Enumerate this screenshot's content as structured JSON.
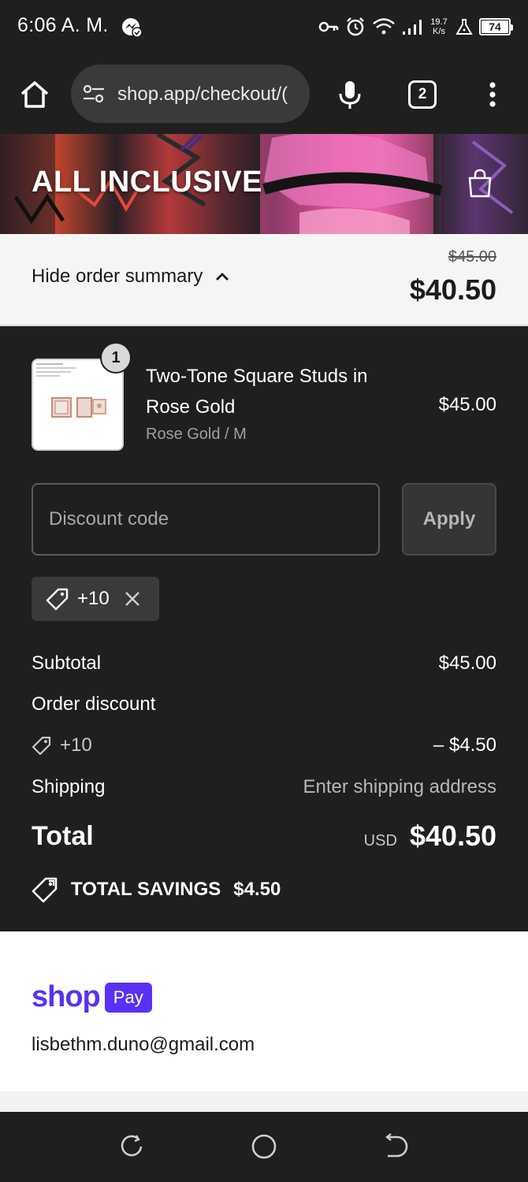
{
  "status_bar": {
    "time": "6:06 A. M.",
    "net_speed_value": "19.7",
    "net_speed_unit": "K/s",
    "battery": "74"
  },
  "browser": {
    "url": "shop.app/checkout/(",
    "tab_count": "2"
  },
  "banner": {
    "title": "ALL INCLUSIVE"
  },
  "summary": {
    "toggle_label": "Hide order summary",
    "original_price": "$45.00",
    "total": "$40.50"
  },
  "product": {
    "quantity": "1",
    "name": "Two-Tone Square Studs in Rose Gold",
    "variant": "Rose Gold / M",
    "price": "$45.00"
  },
  "discount": {
    "placeholder": "Discount code",
    "apply_label": "Apply",
    "applied_code": "+10"
  },
  "totals": {
    "subtotal_label": "Subtotal",
    "subtotal_value": "$45.00",
    "order_discount_label": "Order discount",
    "discount_code": "+10",
    "discount_value": "– $4.50",
    "shipping_label": "Shipping",
    "shipping_value": "Enter shipping address",
    "total_label": "Total",
    "currency": "USD",
    "total_value": "$40.50",
    "savings_label": "TOTAL SAVINGS",
    "savings_value": "$4.50"
  },
  "shop_pay": {
    "brand_word": "shop",
    "pay_badge": "Pay",
    "email": "lisbethm.duno@gmail.com"
  },
  "colors": {
    "background_dark": "#1f1f20",
    "shop_purple": "#5a31f4",
    "summary_bg": "#f5f5f5"
  },
  "icons": {
    "status": [
      "key-icon",
      "alarm-icon",
      "wifi-icon",
      "signal-icon",
      "flask-icon",
      "battery-icon"
    ],
    "browser": [
      "home-icon",
      "tune-icon",
      "mic-icon",
      "tabs-icon",
      "more-vert-icon"
    ],
    "nav": [
      "recents-icon",
      "home-circle-icon",
      "back-icon"
    ]
  }
}
